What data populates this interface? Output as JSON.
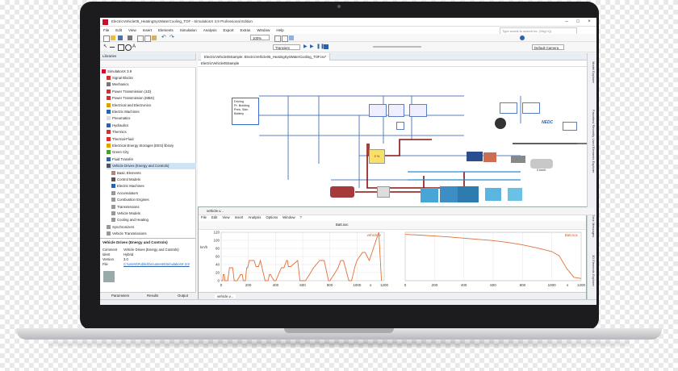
{
  "window": {
    "title": "ElectricVehicle05_HeatingSysWaterCooling_TOF - SimulationX 3.9 Professional Edition",
    "minimize": "–",
    "maximize": "□",
    "close": "×"
  },
  "menu": [
    "File",
    "Edit",
    "View",
    "Insert",
    "Elements",
    "Simulation",
    "Analysis",
    "Export",
    "Extras",
    "Window",
    "Help"
  ],
  "search": {
    "placeholder": "Type words to search for. (Strg+Q)"
  },
  "toolbar": {
    "zoom": "100%",
    "transient": "Transient",
    "camera": "Default Camera"
  },
  "libraries": {
    "title": "Libraries",
    "root": "SimulationX 3.9",
    "items": [
      {
        "label": "Signal Blocks",
        "color": "#c33"
      },
      {
        "label": "Mechanics",
        "color": "#777"
      },
      {
        "label": "Power Transmission (1D)",
        "color": "#c33"
      },
      {
        "label": "Power Transmission (MBS)",
        "color": "#c33"
      },
      {
        "label": "Electrical and Electronics",
        "color": "#d8a000"
      },
      {
        "label": "Electric Machines",
        "color": "#2a62b0"
      },
      {
        "label": "Pneumatics",
        "color": "#ddd"
      },
      {
        "label": "Hydraulics",
        "color": "#2a62b0"
      },
      {
        "label": "Thermics",
        "color": "#c33"
      },
      {
        "label": "Thermal-Fluid",
        "color": "#c33"
      },
      {
        "label": "Electrical Energy Storages (EES) library",
        "color": "#e6a100"
      },
      {
        "label": "Green City",
        "color": "#4a9a3a"
      },
      {
        "label": "Fluid Transfer",
        "color": "#2a62b0"
      },
      {
        "label": "Vehicle Drives (Energy and Controls)",
        "color": "#555",
        "selected": true
      },
      {
        "label": "Basic Elements",
        "color": "#a88"
      },
      {
        "label": "Control Models",
        "color": "#555"
      },
      {
        "label": "Electric Machines",
        "color": "#2a62b0"
      },
      {
        "label": "Accumulators",
        "color": "#999"
      },
      {
        "label": "Combustion Engines",
        "color": "#999"
      },
      {
        "label": "Transmissions",
        "color": "#999"
      },
      {
        "label": "Vehicle Models",
        "color": "#999"
      },
      {
        "label": "Cooling and Heating",
        "color": "#999"
      },
      {
        "label": "Synchronizers",
        "color": "#999"
      },
      {
        "label": "Vehicle Transmissions",
        "color": "#999"
      }
    ]
  },
  "info": {
    "title": "Vehicle Drives (Energy and Controls)",
    "rows": [
      {
        "key": "Comment",
        "value": "Vehicle Drives (Energy and Controls)"
      },
      {
        "key": "Ident",
        "value": "Hybrid"
      },
      {
        "key": "Version",
        "value": "3.0"
      },
      {
        "key": "File",
        "value": "C:\\Users\\Public\\Documents\\SimulationX 3.9"
      }
    ]
  },
  "bottom_tabs": [
    "Parameters",
    "Results",
    "Output"
  ],
  "doc_tab": "ElectricVehicle05Sample: ElectricVehicle05_HeatingSysWaterCooling_TOF.isx*",
  "breadcrumb": "ElectricVehicle05Sample",
  "diagram_labels": {
    "driving": [
      "Driving",
      "Pr. Building",
      "Pres. Skin",
      "Battery"
    ],
    "nedc": "NEDC",
    "speed": "0 km/h",
    "speed2": "0 km/h",
    "soc": "0 %"
  },
  "right_tabs": [
    "Model Explorer",
    "Favorites/ Recently Used Elements Explorer",
    "Error Messages",
    "3D Elements Explorer"
  ],
  "plot": {
    "title": "vehicle.v...",
    "menu": [
      "File",
      "Edit",
      "View",
      "Insert",
      "Analysis",
      "Options",
      "Window",
      "?"
    ],
    "tool_label": "Batt.soc",
    "tab": "vehicle.v..."
  },
  "chart_data": [
    {
      "type": "line",
      "title": "",
      "xlabel": "s",
      "ylabel": "km/h",
      "legend": "vehicle.v",
      "xlim": [
        0,
        1200
      ],
      "ylim": [
        0,
        120
      ],
      "xticks": [
        0,
        200,
        400,
        600,
        800,
        1000,
        1200
      ],
      "yticks": [
        0,
        20,
        40,
        60,
        80,
        100,
        120
      ],
      "x": [
        0,
        11,
        15,
        23,
        28,
        49,
        61,
        85,
        96,
        117,
        143,
        155,
        163,
        178,
        188,
        195,
        207,
        243,
        256,
        275,
        289,
        323,
        346,
        355,
        363,
        389,
        403,
        443,
        462,
        481,
        488,
        495,
        512,
        563,
        580,
        620,
        650,
        680,
        725,
        758,
        790,
        800,
        830,
        860,
        880,
        900,
        940,
        960,
        985,
        1000,
        1040,
        1060,
        1090,
        1110,
        1140,
        1160,
        1180
      ],
      "series": [
        {
          "name": "vehicle.v",
          "values": [
            0,
            0,
            15,
            15,
            0,
            0,
            32,
            32,
            0,
            0,
            15,
            15,
            0,
            0,
            32,
            32,
            50,
            50,
            35,
            35,
            50,
            0,
            0,
            15,
            15,
            0,
            0,
            32,
            32,
            50,
            50,
            35,
            35,
            50,
            0,
            0,
            15,
            32,
            50,
            50,
            0,
            0,
            15,
            32,
            50,
            50,
            0,
            0,
            35,
            50,
            70,
            70,
            50,
            70,
            100,
            120,
            0
          ]
        }
      ]
    },
    {
      "type": "line",
      "title": "",
      "xlabel": "s",
      "legend": "Batt.soc",
      "xlim": [
        0,
        1200
      ],
      "xticks": [
        0,
        200,
        400,
        600,
        800,
        1000,
        1200
      ],
      "x": [
        0,
        100,
        200,
        300,
        400,
        500,
        600,
        700,
        800,
        900,
        1000,
        1050,
        1100,
        1150,
        1200
      ],
      "series": [
        {
          "name": "Batt.soc",
          "values": [
            1.0,
            0.99,
            0.975,
            0.96,
            0.94,
            0.92,
            0.9,
            0.87,
            0.83,
            0.78,
            0.72,
            0.65,
            0.45,
            0.3,
            0.28
          ]
        }
      ]
    }
  ]
}
